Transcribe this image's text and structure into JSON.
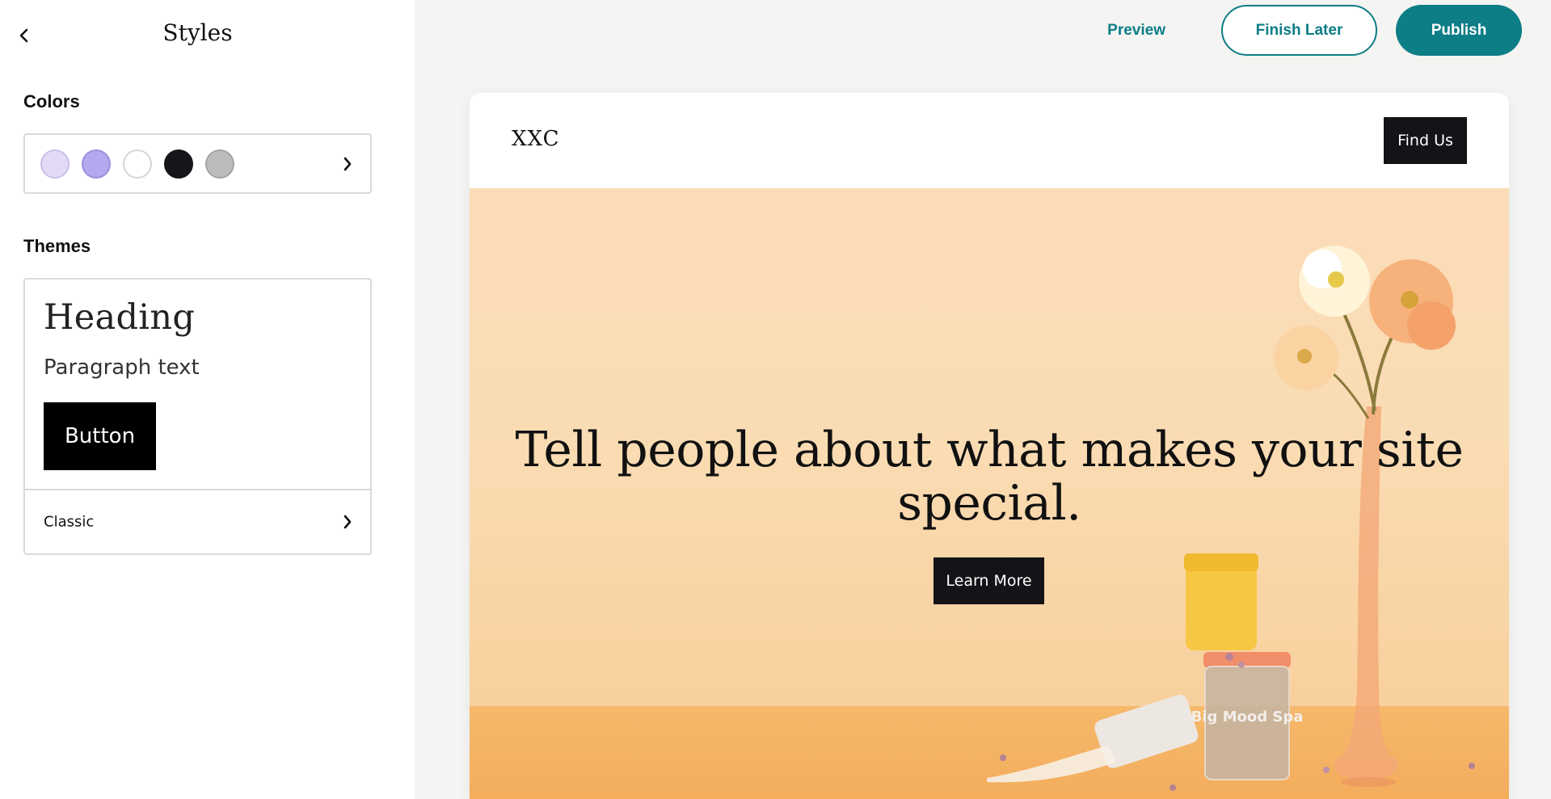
{
  "panel": {
    "title": "Styles",
    "back_icon": "chevron-left-icon",
    "colors": {
      "label": "Colors",
      "swatches": [
        "#e3dbf6",
        "#b5a8ee",
        "#ffffff",
        "#16161a",
        "#bcbcbc"
      ],
      "chevron_icon": "chevron-right-icon"
    },
    "themes": {
      "label": "Themes",
      "preview_heading": "Heading",
      "preview_paragraph": "Paragraph text",
      "preview_button": "Button",
      "current_theme": "Classic",
      "chevron_icon": "chevron-right-icon"
    }
  },
  "topbar": {
    "preview_label": "Preview",
    "finish_later_label": "Finish Later",
    "publish_label": "Publish",
    "accent_color": "#0d7d86"
  },
  "site": {
    "logo": "XXC",
    "nav_button": "Find Us",
    "hero_title_line1": "Tell people about what makes your site",
    "hero_title_line2": "special.",
    "hero_button": "Learn More",
    "product_label": "Big Mood Spa"
  }
}
